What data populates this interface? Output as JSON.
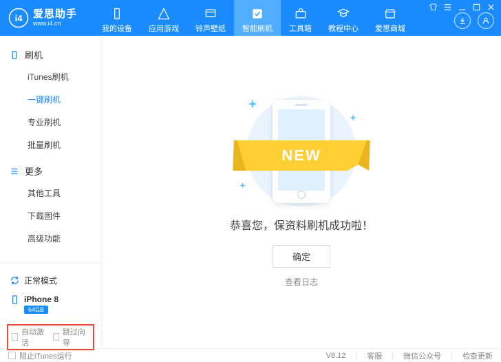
{
  "brand": {
    "cn": "爱思助手",
    "en": "www.i4.cn"
  },
  "tabs": [
    {
      "label": "我的设备"
    },
    {
      "label": "应用游戏"
    },
    {
      "label": "铃声壁纸"
    },
    {
      "label": "智能刷机"
    },
    {
      "label": "工具箱"
    },
    {
      "label": "教程中心"
    },
    {
      "label": "爱思商城"
    }
  ],
  "sidebar": {
    "group1": {
      "title": "刷机",
      "items": [
        "iTunes刷机",
        "一键刷机",
        "专业刷机",
        "批量刷机"
      ]
    },
    "group2": {
      "title": "更多",
      "items": [
        "其他工具",
        "下载固件",
        "高级功能"
      ]
    }
  },
  "status": {
    "mode": "正常模式",
    "device": "iPhone 8",
    "capacity": "64GB"
  },
  "result": {
    "ribbon": "NEW",
    "title": "恭喜您，保资料刷机成功啦！",
    "ok": "确定",
    "log": "查看日志"
  },
  "options": {
    "auto_activate": "自动激活",
    "skip_guide": "跳过向导",
    "block_itunes": "阻止iTunes运行"
  },
  "statusbar": {
    "version": "V8.12",
    "service": "客服",
    "wechat": "微信公众号",
    "update": "检查更新"
  }
}
